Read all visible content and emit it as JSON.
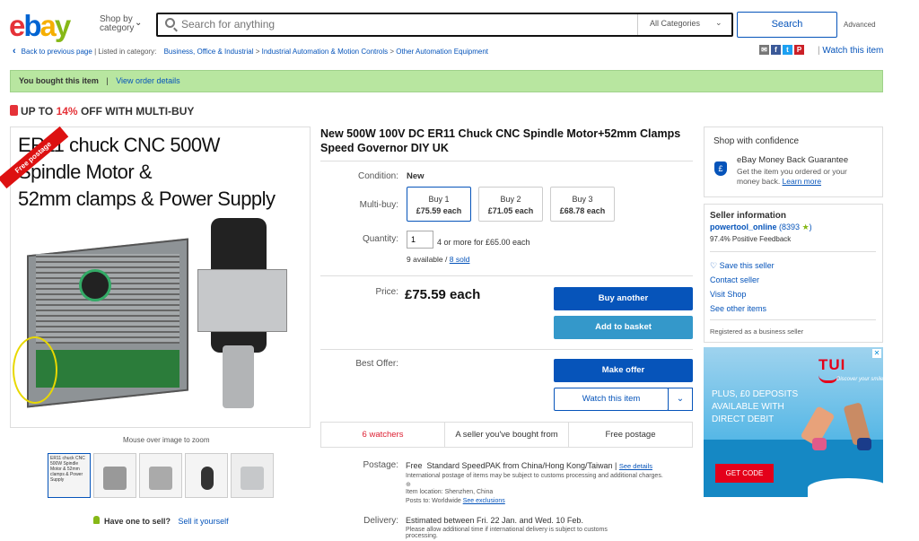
{
  "header": {
    "logo": [
      "e",
      "b",
      "a",
      "y"
    ],
    "shop_by_line1": "Shop by",
    "shop_by_line2": "category",
    "search_placeholder": "Search for anything",
    "category_select": "All Categories",
    "search_button": "Search",
    "advanced": "Advanced"
  },
  "breadcrumb": {
    "back": "Back to previous page",
    "listed_in": "Listed in category:",
    "items": [
      "Business, Office & Industrial",
      "Industrial Automation & Motion Controls",
      "Other Automation Equipment"
    ],
    "separator": ">"
  },
  "share": {
    "icons": [
      "email-icon",
      "facebook-icon",
      "twitter-icon",
      "pinterest-icon"
    ],
    "labels": [
      "✉",
      "f",
      "t",
      "P"
    ],
    "colors": [
      "#777777",
      "#3b5998",
      "#1da1f2",
      "#cb2027"
    ]
  },
  "watch_top": "Watch this item",
  "banner": {
    "text": "You bought this item",
    "sep": "|",
    "link": "View order details",
    "bg": "#b8e6a0"
  },
  "promo": {
    "prefix": "UP TO ",
    "pct": "14%",
    "suffix": " OFF WITH MULTI-BUY"
  },
  "image": {
    "title_lines": [
      "ER11 chuck CNC 500W",
      "Spindle Motor  &",
      "52mm clamps  & Power Supply"
    ],
    "ribbon": "Free postage",
    "mouseover": "Mouse over image to zoom",
    "thumb1_text": "ER11 chuck CNC 500W Spindle Motor & 52mm clamps & Power Supply"
  },
  "sell": {
    "question": "Have one to sell?",
    "link": "Sell it yourself"
  },
  "item": {
    "title": "New 500W 100V DC ER11 Chuck CNC Spindle Motor+52mm Clamps Speed Governor DIY UK",
    "condition_label": "Condition:",
    "condition": "New",
    "multibuy_label": "Multi-buy:",
    "multibuy": [
      {
        "qty": "Buy 1",
        "price": "£75.59 each"
      },
      {
        "qty": "Buy 2",
        "price": "£71.05 each"
      },
      {
        "qty": "Buy 3",
        "price": "£68.78 each"
      }
    ],
    "quantity_label": "Quantity:",
    "quantity": "1",
    "quantity_note": "4 or more for £65.00 each",
    "available": "9 available /",
    "sold": "8 sold",
    "price_label": "Price:",
    "price": "£75.59 each",
    "buy_another": "Buy another",
    "add_basket": "Add to basket",
    "best_offer_label": "Best Offer:",
    "make_offer": "Make offer",
    "watch": "Watch this item",
    "tabs": [
      "6 watchers",
      "A seller you've bought from",
      "Free postage"
    ],
    "postage_label": "Postage:",
    "postage_free": "Free",
    "postage_service": "Standard SpeedPAK from China/Hong Kong/Taiwan |",
    "postage_details": "See details",
    "postage_note": "International postage of items may be subject to customs processing and additional charges.",
    "location": "Item location:  Shenzhen, China",
    "posts_to": "Posts to:  Worldwide",
    "exclusions": "See exclusions",
    "delivery_label": "Delivery:",
    "delivery": "Estimated between Fri. 22 Jan. and Wed. 10 Feb.",
    "delivery_note": "Please allow additional time if international delivery is subject to customs",
    "delivery_note2": "processing."
  },
  "confidence": {
    "title": "Shop with confidence",
    "guarantee_title": "eBay Money Back Guarantee",
    "guarantee_text": "Get the item you ordered or your money back.",
    "learn_more": "Learn more"
  },
  "seller": {
    "title": "Seller information",
    "name": "powertool_online",
    "score": "(8393",
    "score_end": ")",
    "feedback": "97.4% Positive Feedback",
    "save": "Save this seller",
    "contact": "Contact seller",
    "visit": "Visit Shop",
    "other": "See other items",
    "business": "Registered as a business seller"
  },
  "ad": {
    "brand": "TUI",
    "tagline": "Discover your smile",
    "text_lines": [
      "PLUS, £0 DEPOSITS",
      "AVAILABLE WITH",
      "DIRECT DEBIT"
    ],
    "cta": "GET CODE",
    "close": "✕"
  }
}
